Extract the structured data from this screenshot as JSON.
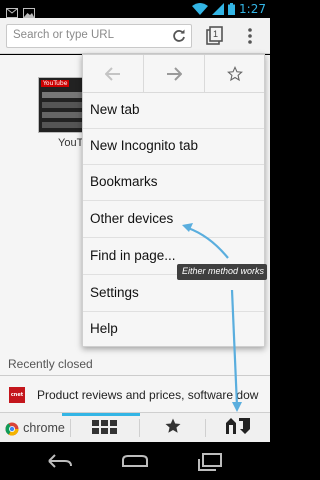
{
  "status_bar": {
    "time": "1:27",
    "icons": [
      "mail-icon",
      "image-icon",
      "wifi-icon",
      "signal-icon",
      "battery-icon"
    ]
  },
  "toolbar": {
    "omnibox_placeholder": "Search or type URL",
    "tab_count": "1",
    "icons": [
      "reload-icon",
      "tabs-icon",
      "overflow-menu-icon"
    ]
  },
  "content": {
    "thumbnail_label": "YouT",
    "thumbnail_badge": "YouTube",
    "recently_closed_heading": "Recently closed",
    "recent_item": {
      "favicon_text": "cnet",
      "title": "Product reviews and prices, software dow"
    }
  },
  "menu": {
    "top_icons": [
      "back-icon",
      "forward-icon",
      "bookmark-star-icon"
    ],
    "items": [
      {
        "label": "New tab"
      },
      {
        "label": "New Incognito tab"
      },
      {
        "label": "Bookmarks"
      },
      {
        "label": "Other devices"
      },
      {
        "label": "Find in page..."
      },
      {
        "label": "Settings"
      },
      {
        "label": "Help"
      }
    ]
  },
  "annotation": {
    "text": "Either method works",
    "color": "#5aaede"
  },
  "bottom_bar": {
    "chrome_label": "chrome",
    "icons": [
      "chrome-logo-icon",
      "most-visited-grid-icon",
      "bookmarks-star-icon",
      "other-devices-icon"
    ],
    "active_indicator_color": "#33b5e5"
  },
  "nav_bar": {
    "icons": [
      "back-nav-icon",
      "home-nav-icon",
      "recents-nav-icon"
    ]
  },
  "colors": {
    "accent": "#33b5e5",
    "menu_bg": "#f6f6f6",
    "content_bg": "#f5f5f5"
  }
}
